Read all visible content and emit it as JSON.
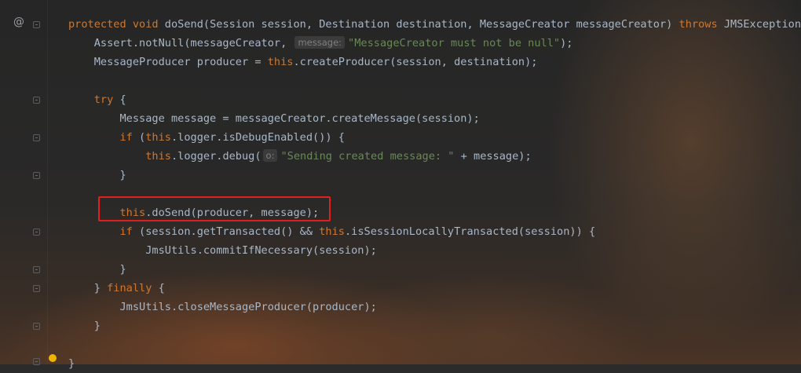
{
  "colors": {
    "background": "#2b2b2b",
    "text": "#a9b7c6",
    "keyword": "#cc7832",
    "string": "#6a8759",
    "highlight_border": "#e02020"
  },
  "gutter": {
    "override_icon": "@",
    "override_icon_name": "override-method-icon",
    "bulb_icon_name": "lightbulb-icon"
  },
  "code": {
    "line1": {
      "kw1": "protected",
      "kw2": "void",
      "sig": " doSend(Session session, Destination destination, MessageCreator messageCreator) ",
      "kw3": "throws",
      "tail": " JMSException {"
    },
    "line2": {
      "pre": "Assert.notNull(messageCreator, ",
      "hint": "message:",
      "str": "\"MessageCreator must not be null\"",
      "post": ");"
    },
    "line3": {
      "pre": "MessageProducer producer = ",
      "kw": "this",
      "post": ".createProducer(session, destination);"
    },
    "line5": {
      "kw": "try",
      "post": " {"
    },
    "line6": {
      "text": "Message message = messageCreator.createMessage(session);"
    },
    "line7": {
      "kw1": "if",
      "mid": " (",
      "kw2": "this",
      "post": ".logger.isDebugEnabled()) {"
    },
    "line8": {
      "kw": "this",
      "pre": ".logger.debug(",
      "hint": "o:",
      "str": "\"Sending created message: \"",
      "post": " + message);"
    },
    "line9": {
      "text": "}"
    },
    "line11": {
      "kw": "this",
      "post": ".doSend(producer, message);"
    },
    "line12": {
      "kw1": "if",
      "mid": " (session.getTransacted() && ",
      "kw2": "this",
      "post": ".isSessionLocallyTransacted(session)) {"
    },
    "line13": {
      "text": "JmsUtils.commitIfNecessary(session);"
    },
    "line14": {
      "text": "}"
    },
    "line15": {
      "pre": "} ",
      "kw": "finally",
      "post": " {"
    },
    "line16": {
      "text": "JmsUtils.closeMessageProducer(producer);"
    },
    "line17": {
      "text": "}"
    },
    "line19": {
      "text": "}"
    }
  }
}
